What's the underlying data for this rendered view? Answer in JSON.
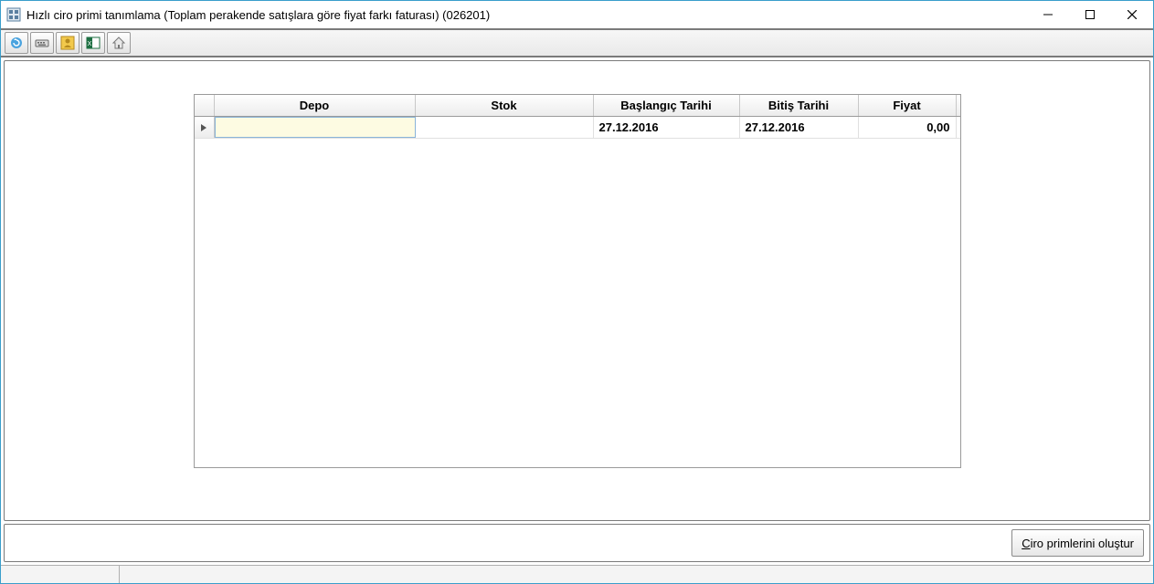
{
  "window": {
    "title": "Hızlı ciro primi tanımlama (Toplam perakende satışlara göre fiyat farkı faturası) (026201)"
  },
  "toolbar": {
    "items": [
      {
        "name": "refresh-icon"
      },
      {
        "name": "keyboard-icon"
      },
      {
        "name": "user-icon"
      },
      {
        "name": "excel-icon"
      },
      {
        "name": "house-icon"
      }
    ]
  },
  "grid": {
    "columns": {
      "depo": "Depo",
      "stok": "Stok",
      "baslangic": "Başlangıç Tarihi",
      "bitis": "Bitiş Tarihi",
      "fiyat": "Fiyat"
    },
    "rows": [
      {
        "depo": "",
        "stok": "",
        "baslangic": "27.12.2016",
        "bitis": "27.12.2016",
        "fiyat": "0,00"
      }
    ]
  },
  "buttons": {
    "create_primary_prefix": "C",
    "create_primary_rest": "iro primlerini oluştur"
  }
}
